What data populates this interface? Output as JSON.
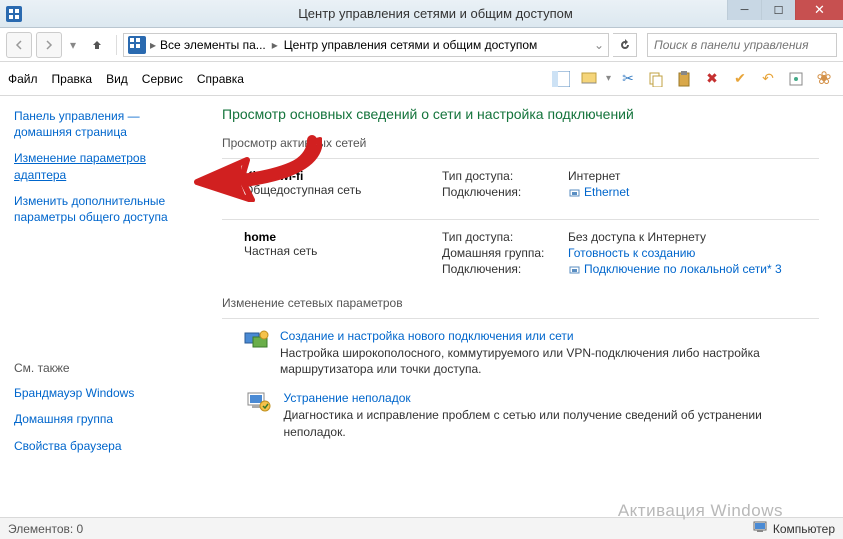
{
  "titlebar": {
    "title": "Центр управления сетями и общим доступом"
  },
  "nav": {
    "crumb1": "Все элементы па...",
    "crumb2": "Центр управления сетями и общим доступом",
    "search_placeholder": "Поиск в панели управления"
  },
  "menu": {
    "file": "Файл",
    "edit": "Правка",
    "view": "Вид",
    "tools": "Сервис",
    "help": "Справка"
  },
  "sidebar": {
    "home": "Панель управления — домашняя страница",
    "adapter": "Изменение параметров адаптера",
    "advanced": "Изменить дополнительные параметры общего доступа",
    "see_also": "См. также",
    "firewall": "Брандмауэр Windows",
    "homegroup": "Домашняя группа",
    "browser": "Свойства браузера"
  },
  "main": {
    "title": "Просмотр основных сведений о сети и настройка подключений",
    "active_label": "Просмотр активных сетей",
    "net1": {
      "name": "Kissa wi-fi",
      "type": "Общедоступная сеть",
      "access_k": "Тип доступа:",
      "access_v": "Интернет",
      "conn_k": "Подключения:",
      "conn_v": "Ethernet"
    },
    "net2": {
      "name": "home",
      "type": "Частная сеть",
      "access_k": "Тип доступа:",
      "access_v": "Без доступа к Интернету",
      "hg_k": "Домашняя группа:",
      "hg_v": "Готовность к созданию",
      "conn_k": "Подключения:",
      "conn_v": "Подключение по локальной сети* 3"
    },
    "settings_label": "Изменение сетевых параметров",
    "s1_title": "Создание и настройка нового подключения или сети",
    "s1_desc": "Настройка широкополосного, коммутируемого или VPN-подключения либо настройка маршрутизатора или точки доступа.",
    "s2_title": "Устранение неполадок",
    "s2_desc": "Диагностика и исправление проблем с сетью или получение сведений об устранении неполадок."
  },
  "statusbar": {
    "left": "Элементов: 0",
    "right": "Компьютер",
    "watermark": "Активация Windows"
  }
}
